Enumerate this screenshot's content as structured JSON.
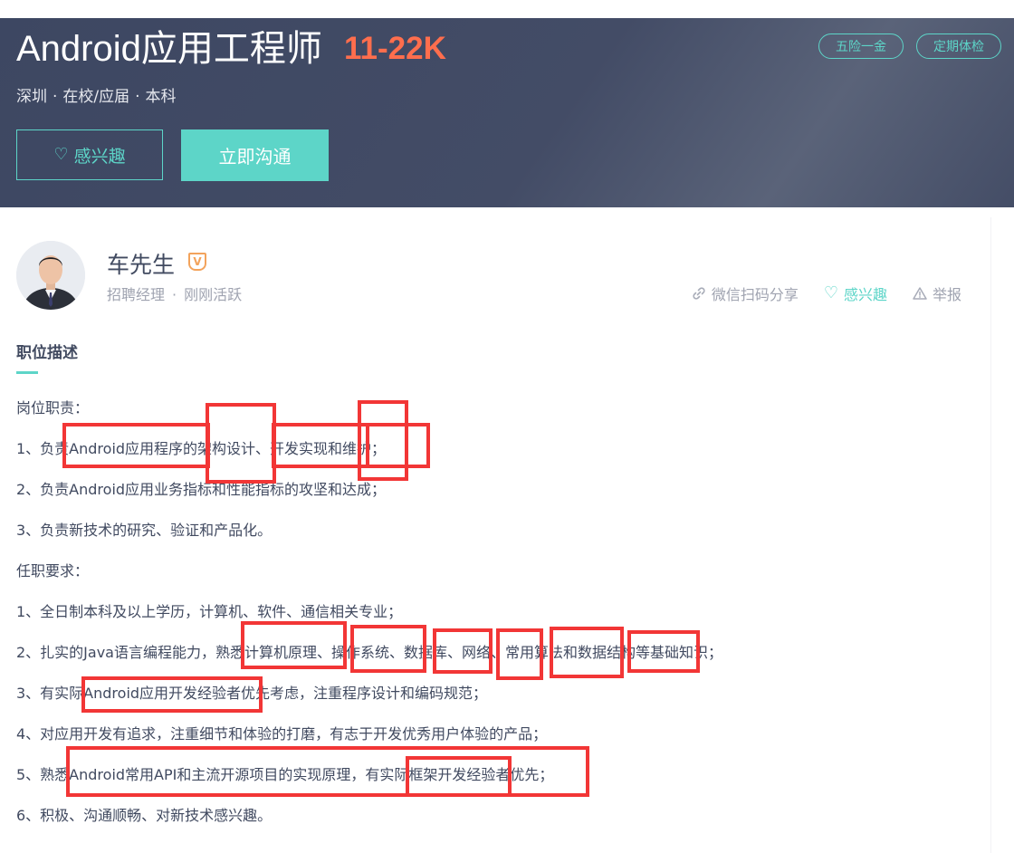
{
  "job": {
    "title": "Android应用工程师",
    "salary": "11-22K",
    "city": "深圳",
    "experience": "在校/应届",
    "education": "本科",
    "dot": "·",
    "tags": [
      "五险一金",
      "定期体检"
    ],
    "interest_label": "感兴趣",
    "chat_label": "立即沟通"
  },
  "recruiter": {
    "name": "车先生",
    "badge": "V",
    "title": "招聘经理",
    "sep": "·",
    "status": "刚刚活跃"
  },
  "actions": {
    "share": "微信扫码分享",
    "interest": "感兴趣",
    "report": "举报"
  },
  "description": {
    "section_title": "职位描述",
    "lines": [
      "岗位职责：",
      "1、负责Android应用程序的架构设计、开发实现和维护；",
      "2、负责Android应用业务指标和性能指标的攻坚和达成；",
      "3、负责新技术的研究、验证和产品化。",
      "任职要求：",
      "1、全日制本科及以上学历，计算机、软件、通信相关专业；",
      "2、扎实的Java语言编程能力，熟悉计算机原理、操作系统、数据库、网络、常用算法和数据结构等基础知识；",
      "3、有实际Android应用开发经验者优先考虑，注重程序设计和编码规范；",
      "4、对应用开发有追求，注重细节和体验的打磨，有志于开发优秀用户体验的产品；",
      "5、熟悉Android常用API和主流开源项目的实现原理，有实际框架开发经验者优先；",
      "6、积极、沟通顺畅、对新技术感兴趣。"
    ]
  },
  "colors": {
    "header_bg": "#434c66",
    "accent": "#5dd5c8",
    "salary": "#ff6e4d",
    "annotation": "#f23636"
  }
}
